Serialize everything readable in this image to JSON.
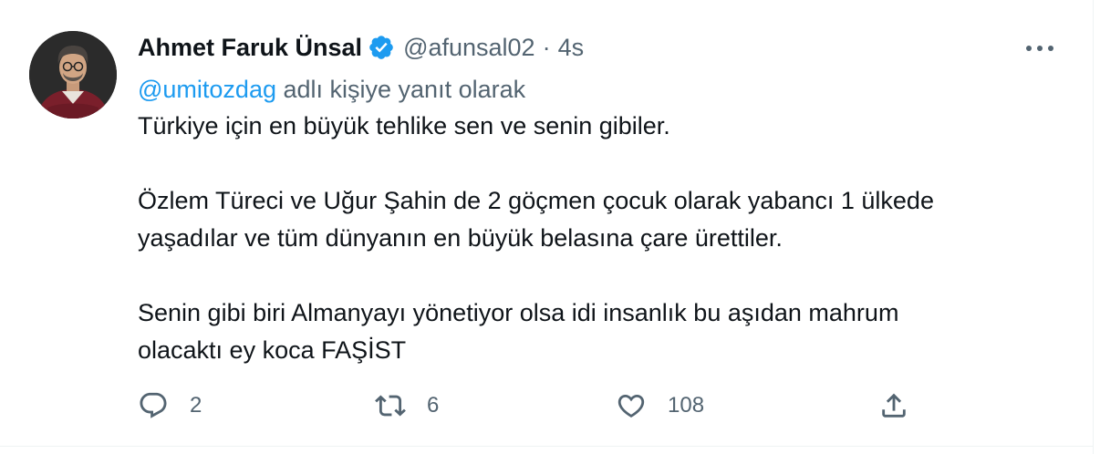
{
  "tweet": {
    "author": {
      "display_name": "Ahmet Faruk Ünsal",
      "verified": true,
      "handle": "@afunsal02",
      "separator": "·",
      "time": "4s"
    },
    "reply_context": {
      "mention": "@umitozdag",
      "suffix": " adlı kişiye yanıt olarak"
    },
    "text_paragraphs": [
      [
        "Türkiye için en büyük tehlike sen ve senin gibiler."
      ],
      [
        "Özlem Türeci ve Uğur Şahin de 2 göçmen çocuk olarak yabancı 1 ülkede",
        "yaşadılar ve tüm dünyanın en büyük belasına çare ürettiler."
      ],
      [
        "Senin gibi biri Almanyayı yönetiyor olsa idi insanlık bu aşıdan mahrum",
        "olacaktı ey koca FAŞİST"
      ]
    ],
    "actions": {
      "reply_count": "2",
      "retweet_count": "6",
      "like_count": "108",
      "share_count": ""
    }
  },
  "colors": {
    "accent": "#1d9bf0",
    "text_primary": "#0f1419",
    "text_secondary": "#536471",
    "border": "#eff3f4"
  },
  "icons": {
    "verified": "verified-badge-icon",
    "more": "more-options-icon",
    "reply": "reply-icon",
    "retweet": "retweet-icon",
    "like": "heart-icon",
    "share": "share-icon"
  }
}
